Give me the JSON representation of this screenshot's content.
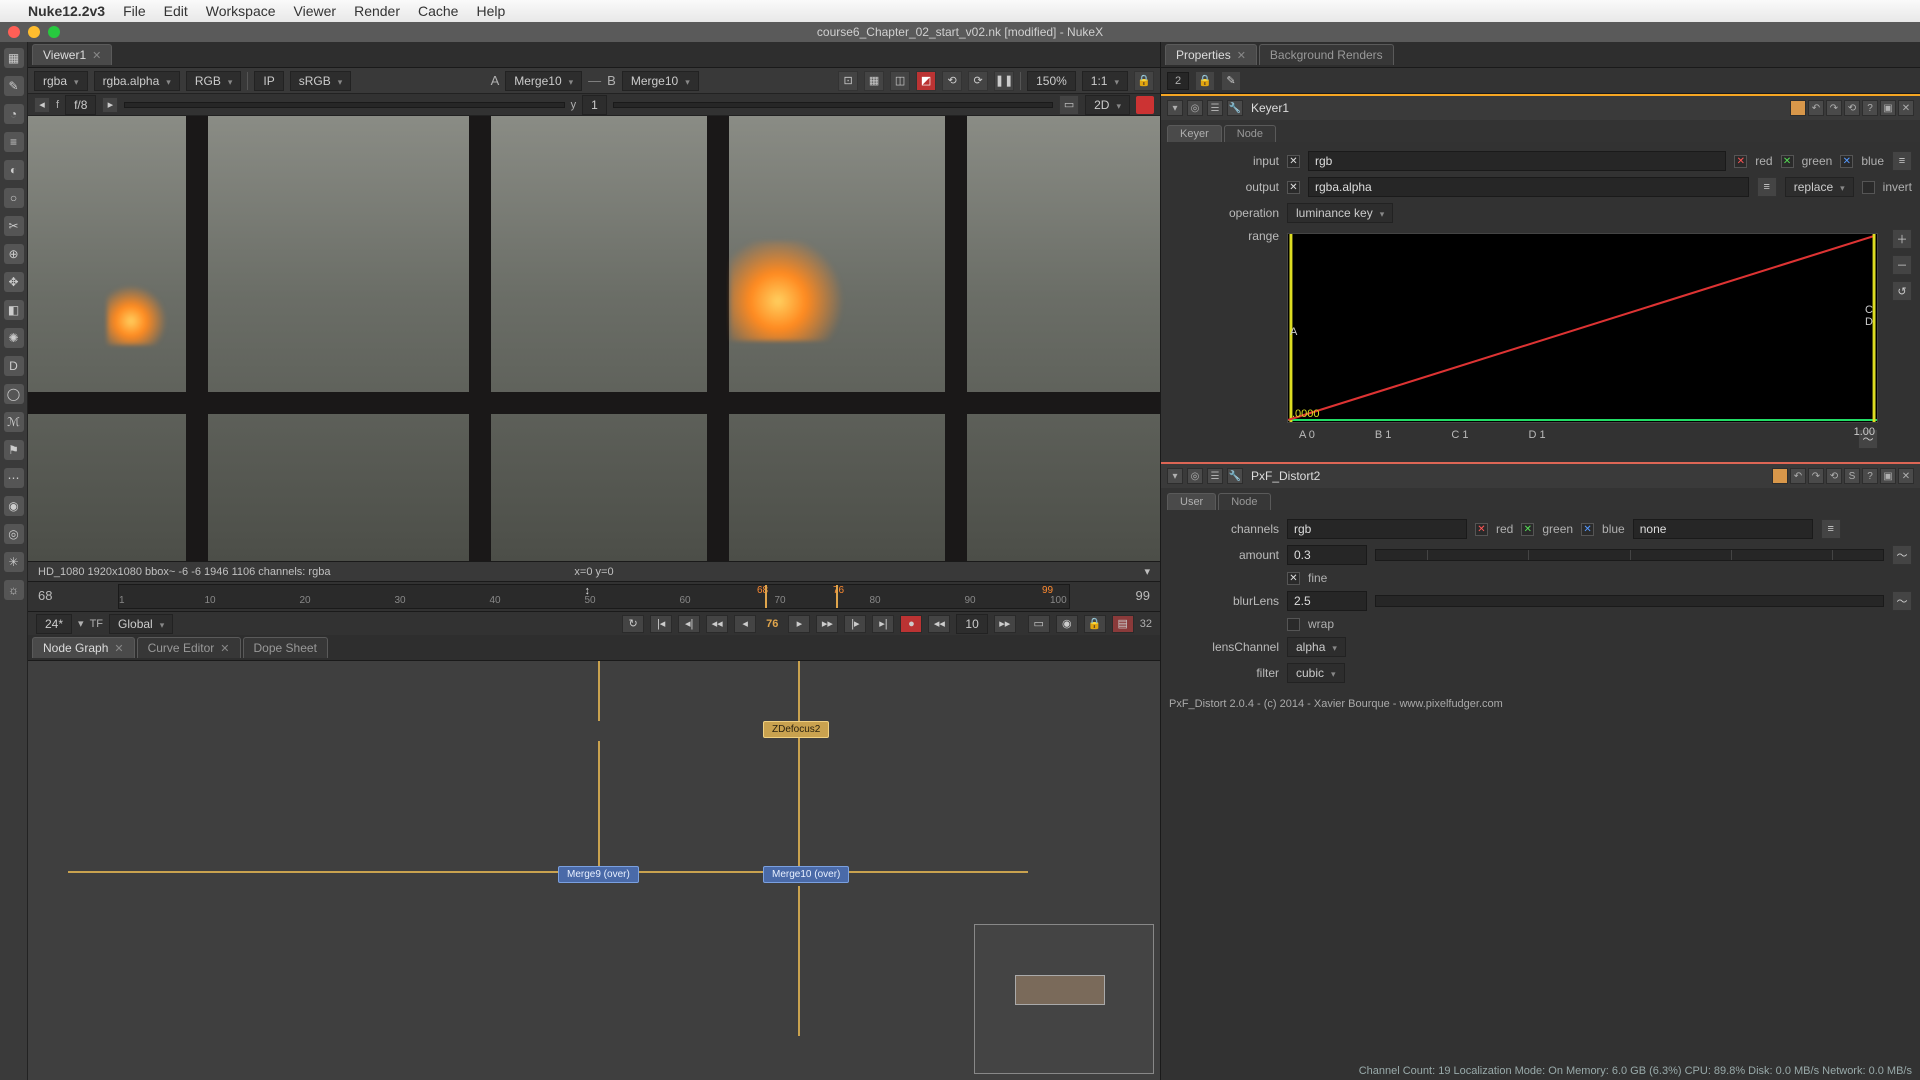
{
  "mac_menu": {
    "app": "Nuke12.2v3",
    "items": [
      "File",
      "Edit",
      "Workspace",
      "Viewer",
      "Render",
      "Cache",
      "Help"
    ]
  },
  "window_title": "course6_Chapter_02_start_v02.nk [modified] - NukeX",
  "viewer_tab": "Viewer1",
  "viewer_bar": {
    "channel": "rgba",
    "layer": "rgba.alpha",
    "color": "RGB",
    "ip": "IP",
    "lut": "sRGB",
    "a_label": "A",
    "a_node": "Merge10",
    "b_label": "B",
    "b_node": "Merge10",
    "zoom": "150%",
    "ratio": "1:1",
    "dim": "2D"
  },
  "fstop": {
    "f_label": "f",
    "f_btn": "f/8",
    "y_label": "y",
    "y_val": "1"
  },
  "image_info": {
    "left": "HD_1080 1920x1080  bbox~ -6 -6 1946 1106 channels: rgba",
    "mid": "x=0 y=0"
  },
  "timeline": {
    "in": "68",
    "out": "99",
    "ticks": [
      "1",
      "10",
      "20",
      "30",
      "40",
      "50",
      "60",
      "70",
      "80",
      "90",
      "100"
    ],
    "marks": [
      {
        "pct": 68,
        "label": "68"
      },
      {
        "pct": 76,
        "label": "76"
      },
      {
        "pct": 99,
        "label": "99"
      }
    ],
    "playhead_text": "↕"
  },
  "transport": {
    "fps": "24*",
    "tf": "TF",
    "global": "Global",
    "current": "76",
    "skip": "10",
    "right_count": "32"
  },
  "ng_tabs": {
    "a": "Node Graph",
    "b": "Curve Editor",
    "c": "Dope Sheet"
  },
  "nodes": {
    "top": "ZDefocus2",
    "left": "Merge9 (over)",
    "right": "Merge10 (over)"
  },
  "right_tabs": {
    "a": "Properties",
    "b": "Background Renders",
    "count": "2"
  },
  "keyer": {
    "name": "Keyer1",
    "tabs": [
      "Keyer",
      "Node"
    ],
    "input_lbl": "input",
    "input_val": "rgb",
    "red": "red",
    "green": "green",
    "blue": "blue",
    "output_lbl": "output",
    "output_val": "rgba.alpha",
    "replace": "replace",
    "invert": "invert",
    "op_lbl": "operation",
    "op_val": "luminance key",
    "range_lbl": "range",
    "curve_low": ".0000",
    "curve_high": "1.00",
    "handles": {
      "a": "A 0",
      "b": "B 1",
      "c": "C 1",
      "d": "D 1"
    }
  },
  "distort": {
    "name": "PxF_Distort2",
    "tabs": [
      "User",
      "Node"
    ],
    "channels_lbl": "channels",
    "channels_val": "rgb",
    "red": "red",
    "green": "green",
    "blue": "blue",
    "none": "none",
    "amount_lbl": "amount",
    "amount_val": "0.3",
    "fine_lbl": "fine",
    "blur_lbl": "blurLens",
    "blur_val": "2.5",
    "wrap_lbl": "wrap",
    "lens_lbl": "lensChannel",
    "lens_val": "alpha",
    "filter_lbl": "filter",
    "filter_val": "cubic",
    "credit": "PxF_Distort 2.0.4 - (c) 2014 - Xavier Bourque - www.pixelfudger.com"
  },
  "statusbar": "Channel Count: 19  Localization Mode: On  Memory: 6.0 GB (6.3%)  CPU: 89.8%  Disk: 0.0 MB/s  Network: 0.0 MB/s"
}
